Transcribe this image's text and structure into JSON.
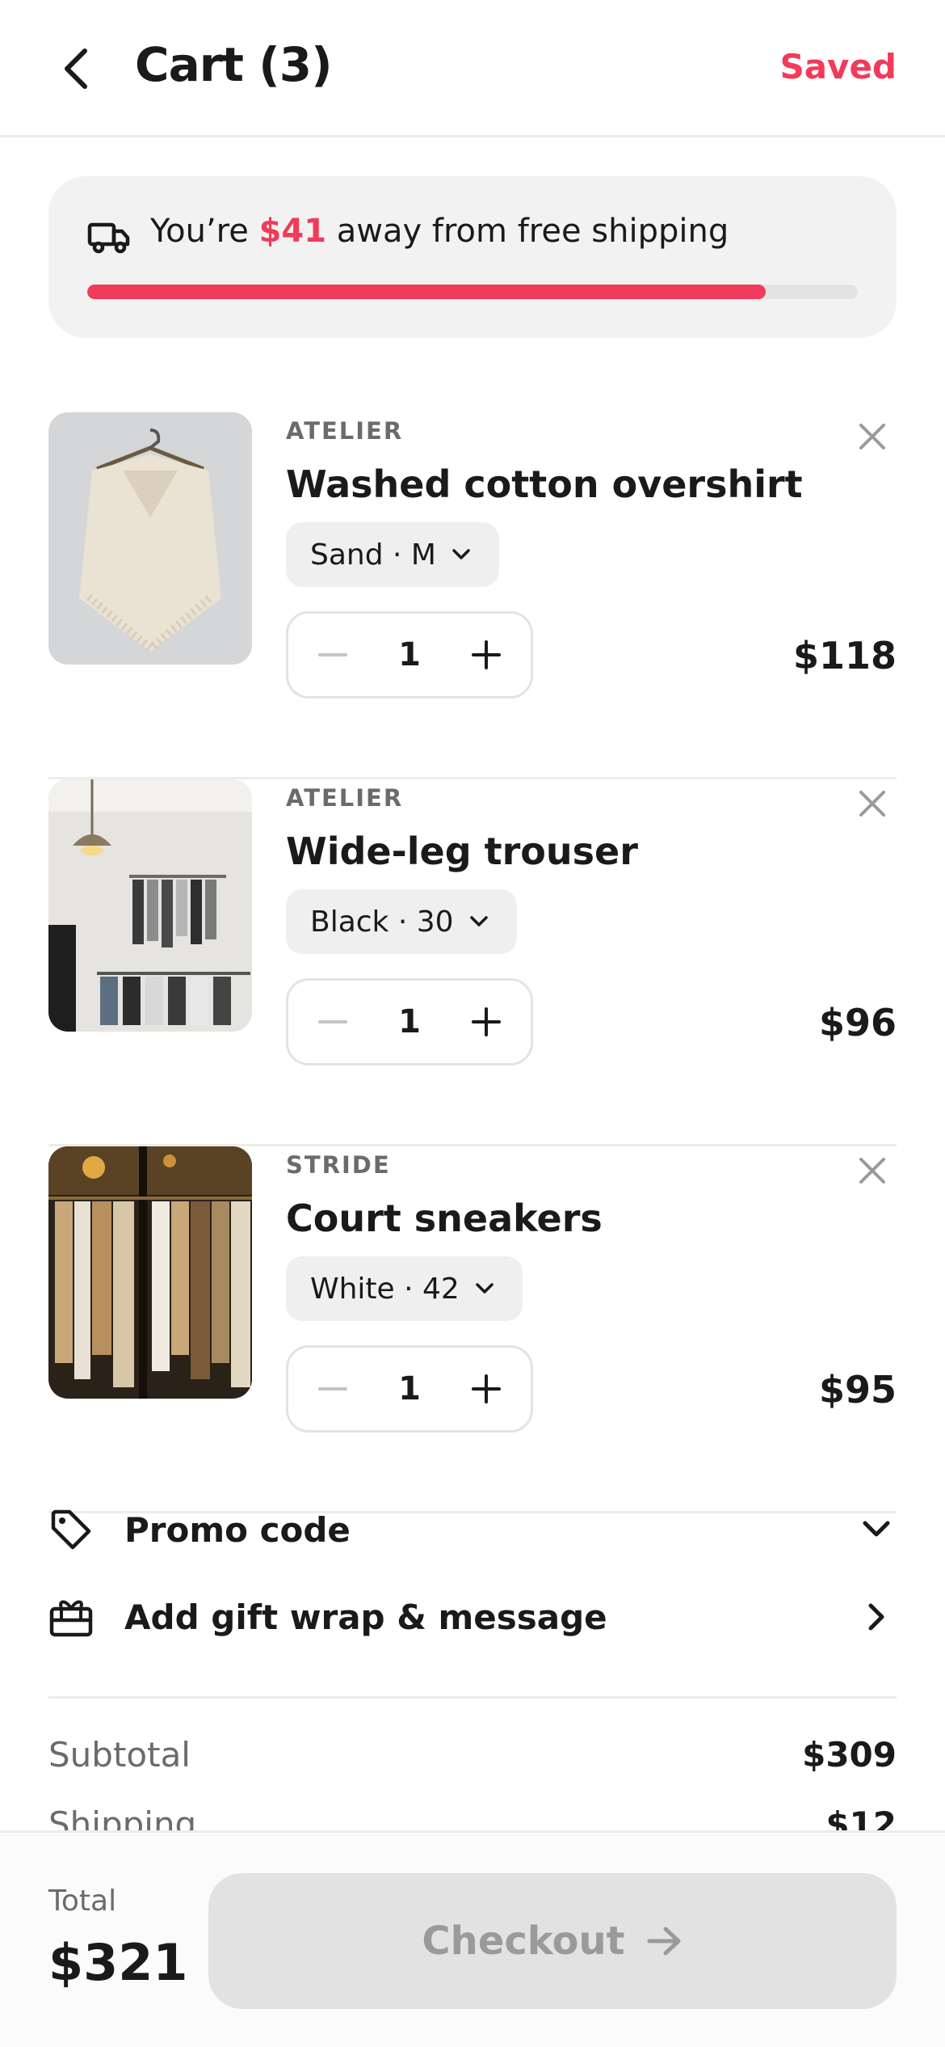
{
  "header": {
    "title": "Cart (3)",
    "saved_label": "Saved"
  },
  "shipping": {
    "prefix": "You’re ",
    "amount": "$41",
    "suffix": " away from free shipping",
    "progress_fraction": 0.88
  },
  "items": [
    {
      "brand": "ATELIER",
      "name": "Washed cotton overshirt",
      "variant": "Sand · M",
      "qty": "1",
      "price": "$118",
      "image": "cream knit poncho on hanger"
    },
    {
      "brand": "ATELIER",
      "name": "Wide-leg trouser",
      "variant": "Black · 30",
      "qty": "1",
      "price": "$96",
      "image": "clothing store rack with pendant lamp"
    },
    {
      "brand": "STRIDE",
      "name": "Court sneakers",
      "variant": "White · 42",
      "qty": "1",
      "price": "$95",
      "image": "shop window with hanging coats"
    }
  ],
  "options": {
    "promo_label": "Promo code",
    "gift_label": "Add gift wrap & message"
  },
  "summary": {
    "subtotal_label": "Subtotal",
    "subtotal_value": "$309",
    "shipping_label": "Shipping",
    "shipping_value": "$12"
  },
  "footer": {
    "total_label": "Total",
    "total_value": "$321",
    "checkout_label": "Checkout"
  },
  "colors": {
    "accent": "#f23a5b",
    "muted": "#6b6b6b",
    "surface": "#f2f2f2"
  },
  "icons": [
    "chevron-left-icon",
    "truck-icon",
    "close-icon",
    "chevron-down-icon",
    "minus-icon",
    "plus-icon",
    "tag-icon",
    "gift-icon",
    "chevron-right-icon",
    "arrow-right-icon"
  ]
}
